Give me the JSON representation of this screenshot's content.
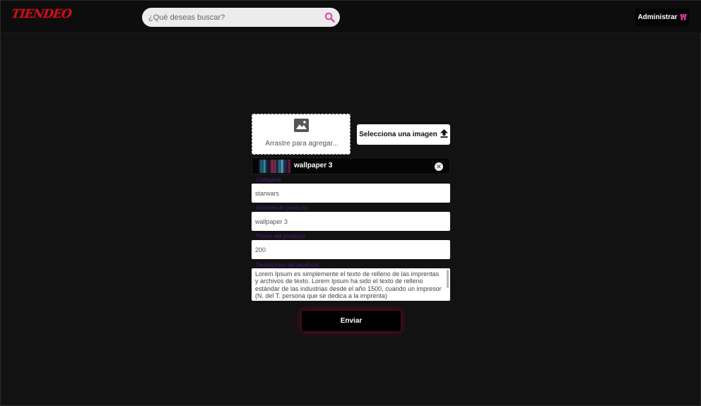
{
  "header": {
    "logo": "TIENDEO",
    "search": {
      "placeholder": "¿Qué deseas buscar?",
      "icon": "search-icon"
    },
    "admin_button": {
      "label": "Administrar",
      "icon": "shop-icon"
    }
  },
  "upload": {
    "dropzone_text": "Arrastre para agregar...",
    "dropzone_icon": "image-icon",
    "select_button": {
      "label": "Selecciona una imagen",
      "icon": "upload-icon"
    },
    "selected_file": {
      "name": "wallpaper 3",
      "remove_icon": "close-icon"
    }
  },
  "form": {
    "category": {
      "label": "Categoria",
      "value": "starwars"
    },
    "product_name": {
      "label": "Nombre de producto",
      "value": "wallpaper 3"
    },
    "price": {
      "label": "Precio del producto",
      "value": "200"
    },
    "description": {
      "label": "Descripcion del producto",
      "value": "Lorem Ipsum es simplemente el texto de relleno de las imprentas y archivos de texto. Lorem Ipsum ha sido el texto de relleno estándar de las industrias desde el año 1500, cuando un impresor (N. del T. persona que se dedica a la imprenta)"
    },
    "submit_label": "Enviar"
  },
  "colors": {
    "background": "#121212",
    "navbar": "#0d0d0d",
    "logo": "#c0141d",
    "accent": "#e0359f",
    "label": "#4a1d8a"
  }
}
